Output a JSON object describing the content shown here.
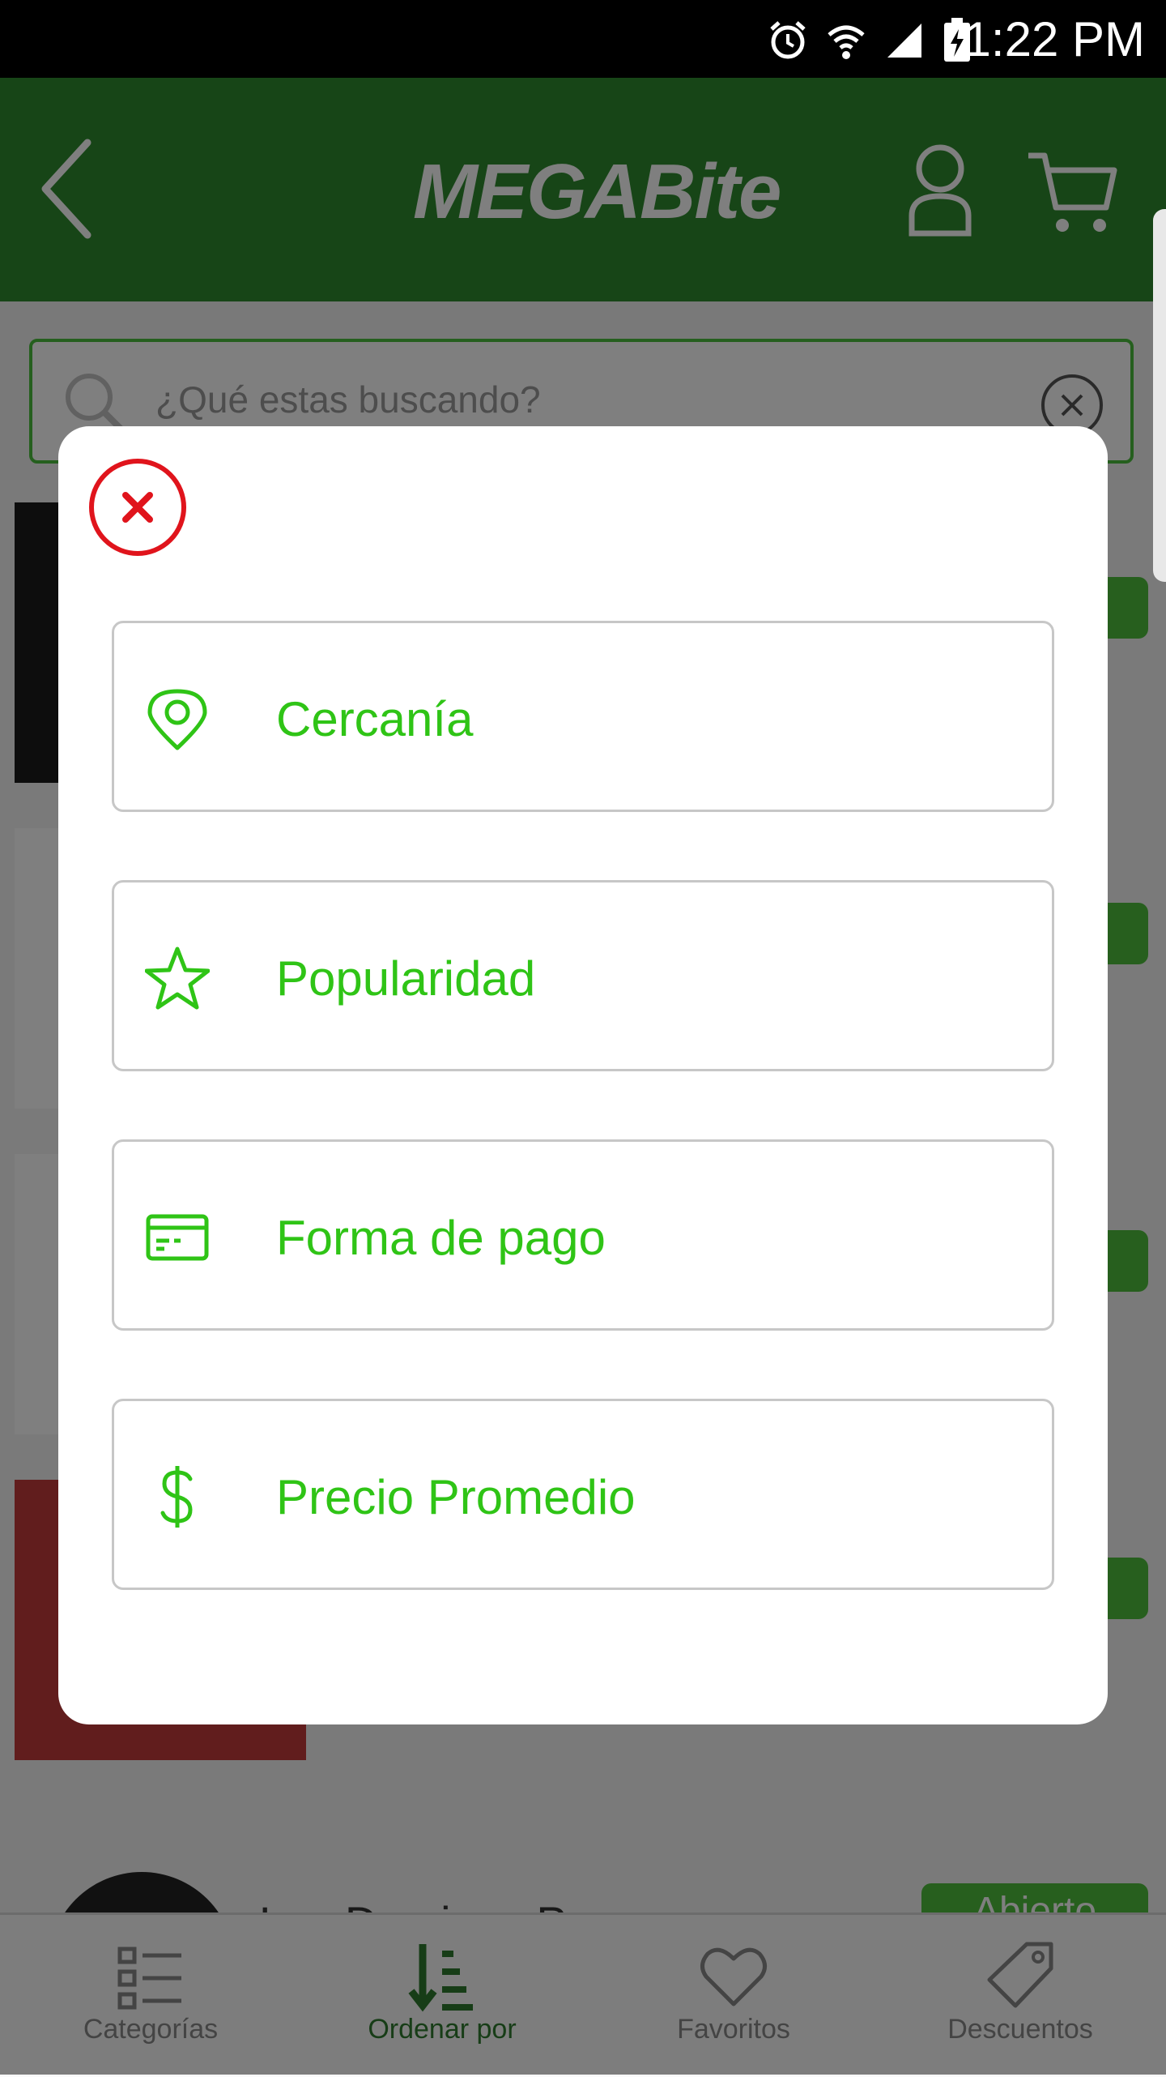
{
  "status_bar": {
    "time": "1:22 PM"
  },
  "app": {
    "logo_text": "MEGABite"
  },
  "search": {
    "placeholder": "¿Qué estas buscando?"
  },
  "background_list": {
    "badge_text": "Abierto",
    "partial_title": "Las Dominos P..."
  },
  "bottom_nav": [
    {
      "label": "Categorías"
    },
    {
      "label": "Ordenar por"
    },
    {
      "label": "Favoritos"
    },
    {
      "label": "Descuentos"
    }
  ],
  "sort_modal": {
    "options": [
      {
        "label": "Cercanía",
        "icon": "location-pin-icon"
      },
      {
        "label": "Popularidad",
        "icon": "star-icon"
      },
      {
        "label": "Forma de pago",
        "icon": "credit-card-icon"
      },
      {
        "label": "Precio Promedio",
        "icon": "dollar-icon"
      }
    ]
  },
  "colors": {
    "brand_green": "#2e8a2e",
    "accent_green": "#2fc416",
    "close_red": "#e0141c"
  }
}
